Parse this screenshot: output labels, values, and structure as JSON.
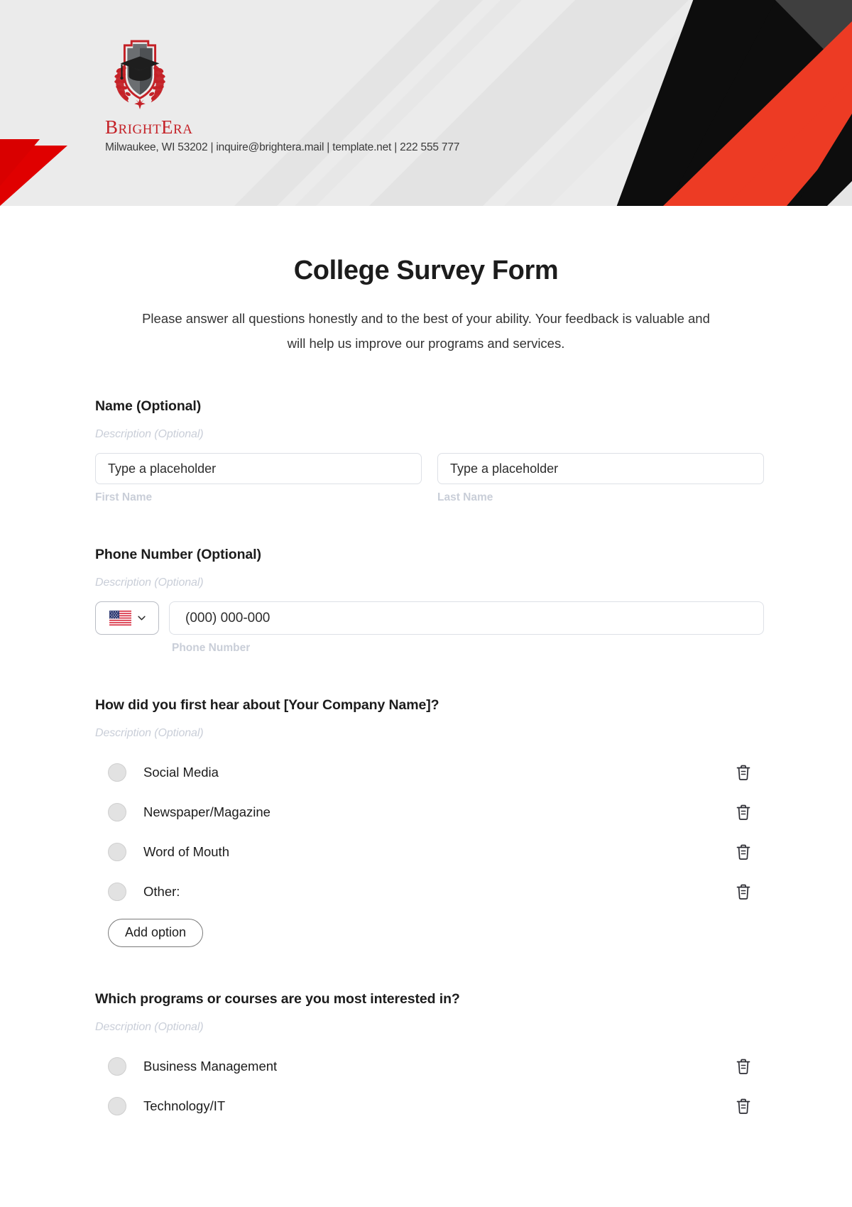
{
  "header": {
    "brand_name": "BrightEra",
    "contact_line": "Milwaukee, WI 53202 | inquire@brightera.mail | template.net | 222 555 777",
    "colors": {
      "background": "#ebebeb",
      "brand_red": "#c42127",
      "accent_red": "#ed3b24",
      "accent_dark": "#0d0d0d",
      "accent_gray": "#3f3f3f"
    }
  },
  "form": {
    "title": "College Survey Form",
    "subtitle": "Please answer all questions honestly and to the best of your ability. Your feedback is valuable and will help us improve our programs and services.",
    "description_placeholder": "Description (Optional)",
    "add_option_label": "Add option",
    "delete_icon": "trash-icon"
  },
  "name_field": {
    "label": "Name (Optional)",
    "description": "Description (Optional)",
    "first": {
      "placeholder": "Type a placeholder",
      "value": "",
      "sub_label": "First Name"
    },
    "last": {
      "placeholder": "Type a placeholder",
      "value": "",
      "sub_label": "Last Name"
    }
  },
  "phone_field": {
    "label": "Phone Number (Optional)",
    "description": "Description (Optional)",
    "country_flag": "us-flag-icon",
    "chevron": "chevron-down-icon",
    "placeholder": "(000) 000-000",
    "value": "",
    "sub_label": "Phone Number"
  },
  "questions": [
    {
      "label": "How did you first hear about [Your Company Name]?",
      "description": "Description (Optional)",
      "options": [
        "Social Media",
        "Newspaper/Magazine",
        "Word of Mouth",
        "Other:"
      ],
      "add_option_label": "Add option"
    },
    {
      "label": "Which programs or courses are you most interested in?",
      "description": "Description (Optional)",
      "options": [
        "Business Management",
        "Technology/IT"
      ]
    }
  ]
}
